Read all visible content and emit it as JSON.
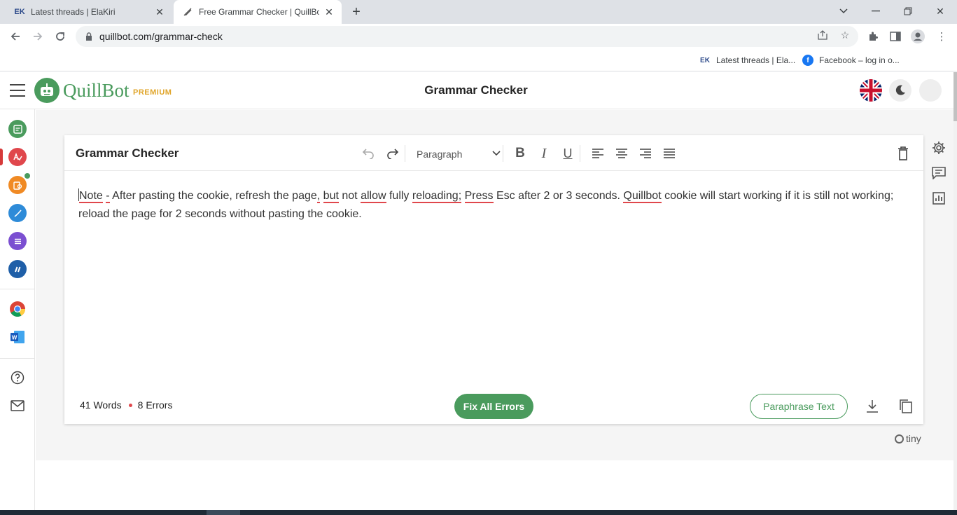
{
  "browser": {
    "tabs": [
      {
        "title": "Latest threads | ElaKiri",
        "favicon": "elakiri-favicon",
        "active": false
      },
      {
        "title": "Free Grammar Checker | QuillBot",
        "favicon": "quill-pen-favicon",
        "active": true
      }
    ],
    "url": "quillbot.com/grammar-check",
    "bookmarks": [
      {
        "label": "Latest threads | Ela...",
        "icon": "elakiri-icon"
      },
      {
        "label": "Facebook – log in o...",
        "icon": "facebook-icon"
      }
    ]
  },
  "header": {
    "brand": "QuillBot",
    "badge": "PREMIUM",
    "title": "Grammar Checker"
  },
  "editor": {
    "title": "Grammar Checker",
    "block_format": "Paragraph",
    "content": [
      {
        "text": "Note",
        "error": true
      },
      {
        "text": " ",
        "error": false
      },
      {
        "text": "-",
        "error": true
      },
      {
        "text": " After pasting the cookie, refresh the page",
        "error": false
      },
      {
        "text": ",",
        "error": true
      },
      {
        "text": " ",
        "error": false
      },
      {
        "text": "but",
        "error": true
      },
      {
        "text": " not ",
        "error": false
      },
      {
        "text": "allow",
        "error": true
      },
      {
        "text": " fully ",
        "error": false
      },
      {
        "text": "reloading;",
        "error": true
      },
      {
        "text": " ",
        "error": false
      },
      {
        "text": "Press",
        "error": true
      },
      {
        "text": " Esc after 2 or 3 seconds. ",
        "error": false
      },
      {
        "text": "Quillbot",
        "error": true
      },
      {
        "text": " cookie will start working if it is still not working; reload the page for 2 seconds without pasting the cookie.",
        "error": false
      }
    ],
    "word_count": "41 Words",
    "error_count": "8 Errors",
    "fix_all_label": "Fix All Errors",
    "paraphrase_label": "Paraphrase Text",
    "powered_by": "tiny"
  },
  "colors": {
    "brand_green": "#4a9b5d",
    "premium_gold": "#e0a52a",
    "error_red": "#e0474c"
  }
}
